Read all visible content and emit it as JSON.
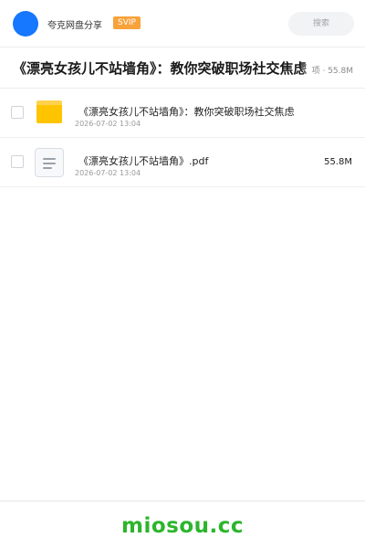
{
  "header": {
    "username": "夸克网盘分享",
    "badge": "SVIP",
    "search_placeholder": "搜索"
  },
  "share": {
    "title": "《漂亮女孩儿不站墙角》：教你突破职场社交焦虑",
    "meta": "项 · 55.8M"
  },
  "files": [
    {
      "name": "《漂亮女孩儿不站墙角》：教你突破职场社交焦虑",
      "date": "2026-07-02 13:04",
      "size": "",
      "icon": "folder-icon"
    },
    {
      "name": "《漂亮女孩儿不站墙角》.pdf",
      "date": "2026-07-02 13:04",
      "size": "55.8M",
      "icon": "document-icon"
    }
  ],
  "footer": {
    "watermark": "miosou.cc"
  },
  "colors": {
    "avatar": "#1677ff",
    "svip": "#f7a23b",
    "folder": "#ffc400",
    "watermark": "#2cb52c"
  }
}
